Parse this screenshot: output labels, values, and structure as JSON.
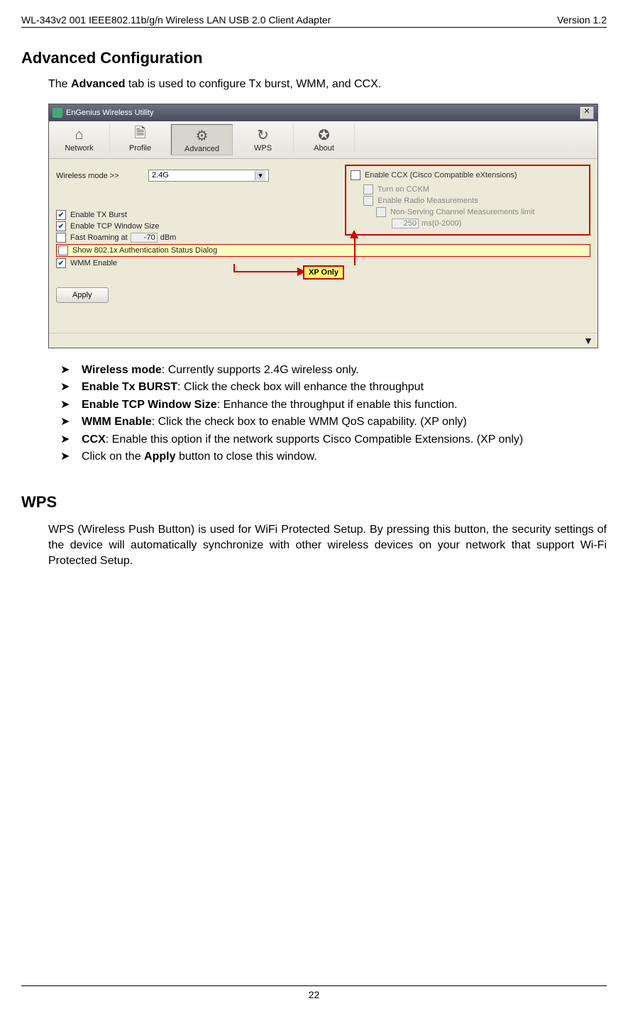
{
  "header": {
    "left": "WL-343v2 001 IEEE802.11b/g/n Wireless LAN USB 2.0 Client Adapter",
    "right": "Version 1.2"
  },
  "section1": {
    "title": "Advanced Configuration",
    "intro_pre": "The ",
    "intro_bold": "Advanced",
    "intro_post": " tab is used to configure Tx burst, WMM, and CCX."
  },
  "app": {
    "window_title": "EnGenius Wireless Utility",
    "tabs": {
      "network": "Network",
      "profile": "Profile",
      "advanced": "Advanced",
      "wps": "WPS",
      "about": "About"
    },
    "wireless_label": "Wireless mode >>",
    "wireless_value": "2.4G",
    "checks": {
      "tx_burst": "Enable TX Burst",
      "tcp_win": "Enable TCP Window Size",
      "fast_roam": "Fast Roaming at",
      "fast_roam_val": "-70",
      "fast_roam_unit": "dBm",
      "show8021x": "Show 802.1x Authentication Status Dialog",
      "wmm": "WMM Enable"
    },
    "ccx": {
      "enable": "Enable CCX (Cisco Compatible eXtensions)",
      "cckm": "Turn on CCKM",
      "radio": "Enable Radio Measurements",
      "nonserv": "Non-Serving Channel Measurements limit",
      "ms_val": "250",
      "ms_unit": "ms(0-2000)"
    },
    "xp_label": "XP Only",
    "apply": "Apply"
  },
  "bullets": [
    {
      "bold": " Wireless mode",
      "rest": ": Currently supports 2.4G wireless only."
    },
    {
      "bold": "Enable Tx BURST",
      "rest": ": Click the check box will enhance the throughput"
    },
    {
      "bold": "Enable TCP Window Size",
      "rest": ": Enhance the throughput if enable this function."
    },
    {
      "bold": "WMM Enable",
      "rest": ": Click the check box to enable WMM QoS capability. (XP only)"
    },
    {
      "bold": "CCX",
      "rest": ": Enable this option if the network supports Cisco Compatible Extensions. (XP only)"
    },
    {
      "pre": "Click on the ",
      "bold": "Apply",
      "rest": " button to close this window."
    }
  ],
  "section2": {
    "title": "WPS",
    "body": "WPS (Wireless Push Button) is used for WiFi Protected Setup. By pressing this button, the security settings of the device will automatically synchronize with other wireless devices on your network that support Wi-Fi Protected Setup."
  },
  "footer": {
    "page": "22"
  }
}
